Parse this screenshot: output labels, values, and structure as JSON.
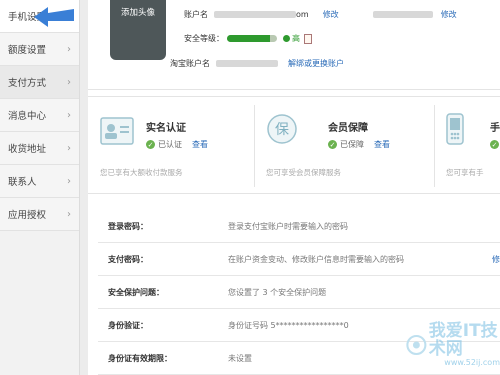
{
  "sidebar": {
    "items": [
      {
        "label": "手机设置"
      },
      {
        "label": "额度设置"
      },
      {
        "label": "支付方式"
      },
      {
        "label": "消息中心"
      },
      {
        "label": "收货地址"
      },
      {
        "label": "联系人"
      },
      {
        "label": "应用授权"
      }
    ],
    "chevron": "›"
  },
  "profile": {
    "avatar_label": "添加头像",
    "account_label": "账户名",
    "account_suffix": "om",
    "edit1": "修改",
    "edit2": "修改",
    "security_label": "安全等级：",
    "security_level_text": "高",
    "security_level": 0.85,
    "taobao_label": "淘宝账户名",
    "taobao_action": "解绑或更换账户"
  },
  "cards": [
    {
      "title": "实名认证",
      "status": "已认证",
      "action": "查看",
      "desc": "您已享有大额收付款服务"
    },
    {
      "title": "会员保障",
      "status": "已保障",
      "action": "查看",
      "desc": "您可享受会员保障服务"
    },
    {
      "title": "手",
      "status": "已",
      "action": "",
      "desc": "您可享有手"
    }
  ],
  "rows": [
    {
      "label": "登录密码：",
      "value": "登录支付宝账户时需要输入的密码"
    },
    {
      "label": "支付密码：",
      "value": "在账户资金变动、修改账户信息时需要输入的密码",
      "action": "修"
    },
    {
      "label": "安全保护问题：",
      "value": "您设置了 3 个安全保护问题"
    },
    {
      "label": "身份验证：",
      "value": "身份证号码 5*****************0"
    },
    {
      "label": "身份证有效期限：",
      "value": "未设置"
    }
  ],
  "watermark": {
    "text": "我爱IT技术网",
    "url": "www.52ij.com"
  },
  "colors": {
    "link": "#2a6bb8",
    "green": "#2e9a2e",
    "arrow": "#3a7fd6"
  }
}
